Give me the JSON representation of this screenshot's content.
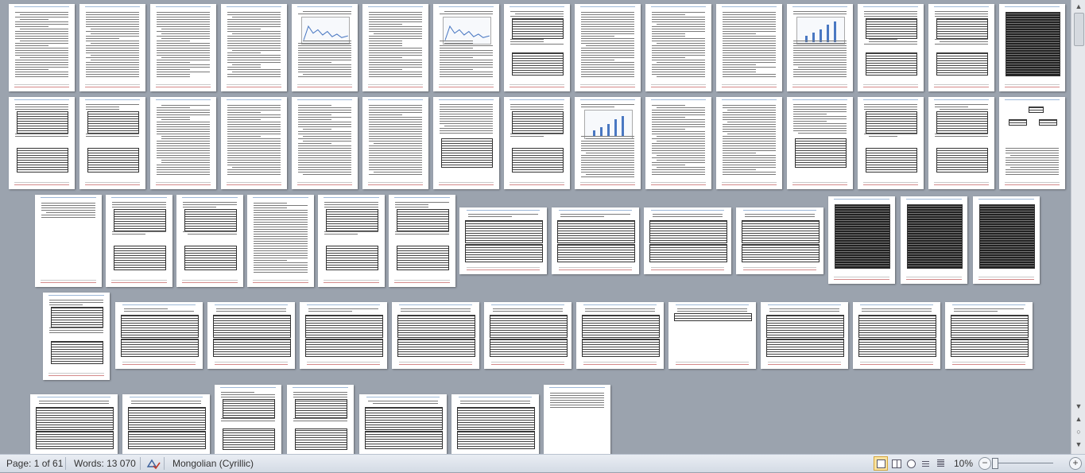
{
  "statusbar": {
    "page_label": "Page: 1 of 61",
    "words_label": "Words: 13 070",
    "language": "Mongolian (Cyrillic)",
    "zoom": "10%"
  },
  "icons": {
    "spellcheck": "spelling-check-icon",
    "print_layout": "print-layout-view-icon",
    "full_screen": "full-screen-reading-icon",
    "web_layout": "web-layout-icon",
    "outline": "outline-view-icon",
    "draft": "draft-view-icon",
    "zoom_out": "zoom-out-icon",
    "zoom_in": "zoom-in-icon",
    "scroll_up": "scroll-up-icon",
    "scroll_down": "scroll-down-icon"
  },
  "colors": {
    "workspace": "#9ba3ae",
    "active_view": "#fbe3a0"
  }
}
